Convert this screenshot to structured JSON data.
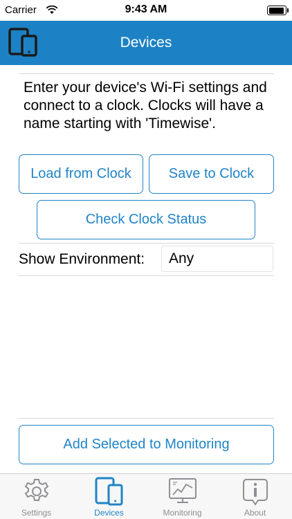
{
  "status_bar": {
    "carrier": "Carrier",
    "time": "9:43 AM"
  },
  "nav": {
    "title": "Devices",
    "icon": "devices-icon"
  },
  "intro_text": "Enter your device's Wi-Fi settings and connect to a clock. Clocks will have a name starting with 'Timewise'.",
  "buttons": {
    "load_from_clock": "Load from Clock",
    "save_to_clock": "Save to Clock",
    "check_clock_status": "Check Clock Status",
    "add_selected": "Add Selected to Monitoring"
  },
  "environment": {
    "label": "Show Environment:",
    "value": "Any"
  },
  "tabs": [
    {
      "label": "Settings",
      "icon": "gear-icon",
      "active": false
    },
    {
      "label": "Devices",
      "icon": "devices-icon",
      "active": true
    },
    {
      "label": "Monitoring",
      "icon": "monitor-chart-icon",
      "active": false
    },
    {
      "label": "About",
      "icon": "info-icon",
      "active": false
    }
  ],
  "colors": {
    "accent": "#1d82c5",
    "inactive": "#8e8e93"
  }
}
